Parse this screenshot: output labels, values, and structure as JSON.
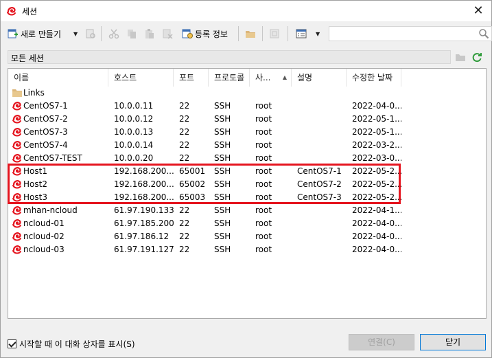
{
  "window": {
    "title": "세션",
    "close_glyph": "✕"
  },
  "toolbar": {
    "new_label": "새로 만들기",
    "register_label": "등록 정보",
    "search_placeholder": "",
    "icons": [
      "new-session-icon",
      "properties-icon",
      "cut-icon",
      "copy-icon",
      "paste-icon",
      "delete-icon",
      "register-info-icon",
      "folder-icon",
      "blank-page-icon",
      "view-list-icon"
    ]
  },
  "path": {
    "label": "모든 세션"
  },
  "list": {
    "columns": [
      "이름",
      "호스트",
      "포트",
      "프로토콜",
      "사...",
      "설명",
      "수정한 날짜"
    ],
    "sort_indicator": "▲",
    "rows": [
      {
        "type": "folder",
        "name": "Links",
        "host": "",
        "port": "",
        "protocol": "",
        "user": "",
        "desc": "",
        "date": ""
      },
      {
        "type": "session",
        "name": "CentOS7-1",
        "host": "10.0.0.11",
        "port": "22",
        "protocol": "SSH",
        "user": "root",
        "desc": "",
        "date": "2022-04-0..."
      },
      {
        "type": "session",
        "name": "CentOS7-2",
        "host": "10.0.0.12",
        "port": "22",
        "protocol": "SSH",
        "user": "root",
        "desc": "",
        "date": "2022-05-1..."
      },
      {
        "type": "session",
        "name": "CentOS7-3",
        "host": "10.0.0.13",
        "port": "22",
        "protocol": "SSH",
        "user": "root",
        "desc": "",
        "date": "2022-05-1..."
      },
      {
        "type": "session",
        "name": "CentOS7-4",
        "host": "10.0.0.14",
        "port": "22",
        "protocol": "SSH",
        "user": "root",
        "desc": "",
        "date": "2022-03-2..."
      },
      {
        "type": "session",
        "name": "CentOS7-TEST",
        "host": "10.0.0.20",
        "port": "22",
        "protocol": "SSH",
        "user": "root",
        "desc": "",
        "date": "2022-03-0..."
      },
      {
        "type": "session",
        "name": "Host1",
        "host": "192.168.200....",
        "port": "65001",
        "protocol": "SSH",
        "user": "root",
        "desc": "CentOS7-1",
        "date": "2022-05-2..."
      },
      {
        "type": "session",
        "name": "Host2",
        "host": "192.168.200....",
        "port": "65002",
        "protocol": "SSH",
        "user": "root",
        "desc": "CentOS7-2",
        "date": "2022-05-2..."
      },
      {
        "type": "session",
        "name": "Host3",
        "host": "192.168.200....",
        "port": "65003",
        "protocol": "SSH",
        "user": "root",
        "desc": "CentOS7-3",
        "date": "2022-05-2..."
      },
      {
        "type": "session",
        "name": "mhan-ncloud",
        "host": "61.97.190.133",
        "port": "22",
        "protocol": "SSH",
        "user": "root",
        "desc": "",
        "date": "2022-04-1..."
      },
      {
        "type": "session",
        "name": "ncloud-01",
        "host": "61.97.185.200",
        "port": "22",
        "protocol": "SSH",
        "user": "root",
        "desc": "",
        "date": "2022-04-0..."
      },
      {
        "type": "session",
        "name": "ncloud-02",
        "host": "61.97.186.12",
        "port": "22",
        "protocol": "SSH",
        "user": "root",
        "desc": "",
        "date": "2022-04-0..."
      },
      {
        "type": "session",
        "name": "ncloud-03",
        "host": "61.97.191.127",
        "port": "22",
        "protocol": "SSH",
        "user": "root",
        "desc": "",
        "date": "2022-04-0..."
      }
    ]
  },
  "footer": {
    "startup_checkbox_label": "시작할 때 이 대화 상자를 표시(S)",
    "startup_checked": true,
    "connect_label": "연결(C)",
    "close_label": "닫기"
  },
  "colors": {
    "accent_red": "#e5141e",
    "folder": "#dcb67a",
    "refresh_green": "#2e9b3a"
  }
}
